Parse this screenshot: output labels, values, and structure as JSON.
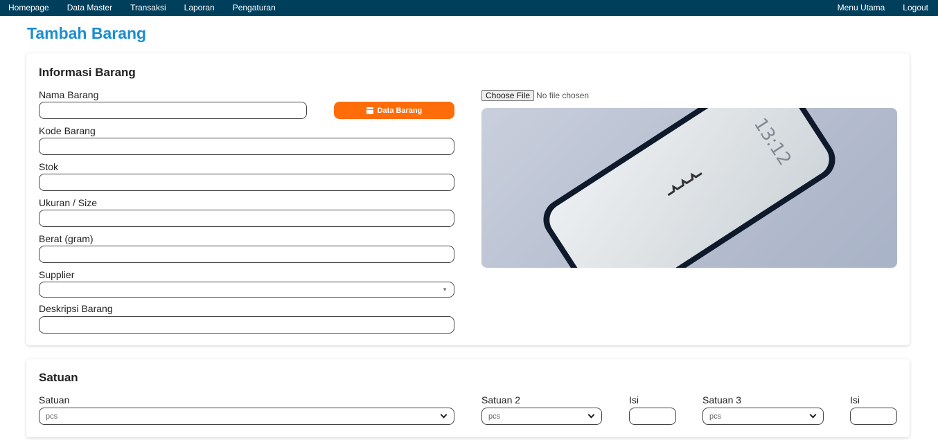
{
  "nav": {
    "left": [
      "Homepage",
      "Data Master",
      "Transaksi",
      "Laporan",
      "Pengaturan"
    ],
    "right": [
      "Menu Utama",
      "Logout"
    ]
  },
  "page": {
    "title": "Tambah Barang"
  },
  "info": {
    "title": "Informasi Barang",
    "labels": {
      "nama": "Nama Barang",
      "kode": "Kode Barang",
      "stok": "Stok",
      "ukuran": "Ukuran / Size",
      "berat": "Berat (gram)",
      "supplier": "Supplier",
      "deskripsi": "Deskripsi Barang"
    },
    "data_barang_button": "Data Barang",
    "file": {
      "button": "Choose File",
      "status": "No file chosen"
    },
    "preview_icon": "phone-photo",
    "phone_time": "13:12"
  },
  "satuan": {
    "title": "Satuan",
    "labels": {
      "satuan": "Satuan",
      "satuan2": "Satuan 2",
      "isi1": "Isi",
      "satuan3": "Satuan 3",
      "isi2": "Isi"
    },
    "values": {
      "satuan": "pcs",
      "satuan2": "pcs",
      "satuan3": "pcs"
    }
  },
  "colors": {
    "navbar": "#003f5c",
    "title": "#1a8fd1",
    "button": "#ff6d0a"
  }
}
